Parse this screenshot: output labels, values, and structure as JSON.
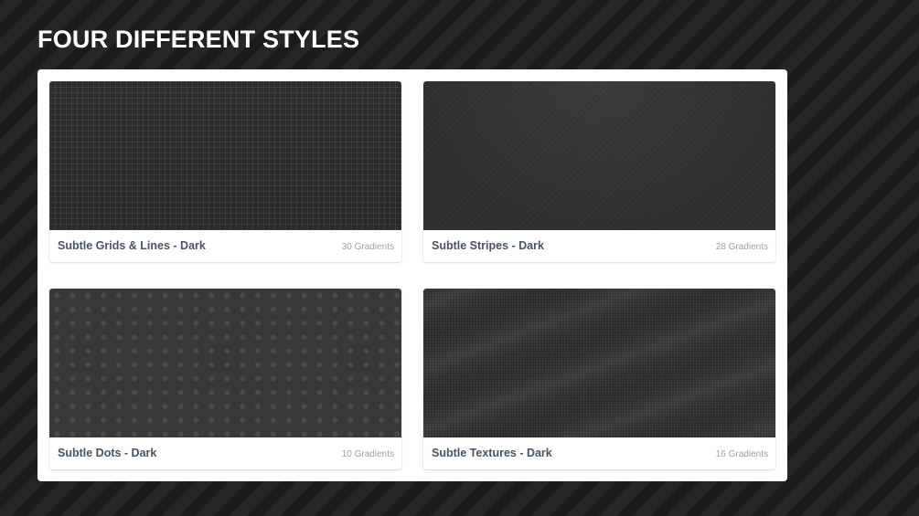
{
  "page": {
    "title": "FOUR DIFFERENT STYLES"
  },
  "cards": [
    {
      "name": "Subtle Grids & Lines - Dark",
      "count": "30 Gradients",
      "pattern": "grid"
    },
    {
      "name": "Subtle Stripes - Dark",
      "count": "28 Gradients",
      "pattern": "stripes"
    },
    {
      "name": "Subtle Dots - Dark",
      "count": "10 Gradients",
      "pattern": "dots"
    },
    {
      "name": "Subtle Textures - Dark",
      "count": "16 Gradients",
      "pattern": "textures"
    }
  ],
  "colors": {
    "background": "#232323",
    "panel": "#ffffff",
    "card_title": "#475466",
    "card_count": "#9aa1a8"
  }
}
